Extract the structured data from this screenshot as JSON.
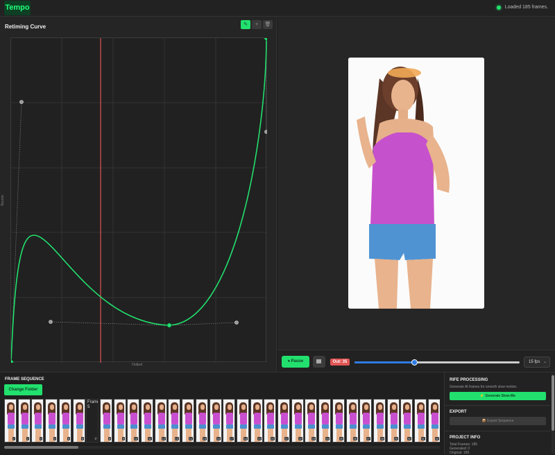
{
  "app": {
    "logo": "Tempo"
  },
  "status": {
    "text": "Loaded 185 frames."
  },
  "curve_panel": {
    "title": "Retiming Curve",
    "tools": [
      "pen-icon",
      "plus-icon",
      "trash-icon"
    ],
    "x_label": "Output",
    "y_label": "Source"
  },
  "playback": {
    "play_label": "⏸ Pause",
    "stop_icon": "stop-icon",
    "out_badge": "Out: 35",
    "progress": 0.36,
    "fps_value": "15 fps"
  },
  "sequence": {
    "title": "FRAME SEQUENCE",
    "change_folder_label": "Change Folder",
    "missing_alt": "Frame 5",
    "frame_numbers": [
      "1",
      "2",
      "3",
      "4",
      "5",
      "6",
      "7",
      "8",
      "9",
      "10",
      "11",
      "12",
      "13",
      "14",
      "15",
      "16",
      "17",
      "18",
      "19",
      "20",
      "21",
      "22",
      "23",
      "24",
      "25",
      "26",
      "27",
      "28",
      "29",
      "30",
      "31",
      "32"
    ]
  },
  "rife": {
    "title": "RIFE PROCESSING",
    "description": "Generate AI frames for smooth slow motion.",
    "generate_label": "⚡ Generate Slow-Mo"
  },
  "export": {
    "title": "EXPORT",
    "button_label": "📦 Export Sequence"
  },
  "project_info": {
    "title": "PROJECT INFO",
    "lines": [
      "Total Frames: 185",
      "Generated: 0",
      "Original: 185"
    ]
  },
  "colors": {
    "accent": "#22e06e",
    "playhead": "#e25555",
    "slider": "#2f7be3"
  }
}
